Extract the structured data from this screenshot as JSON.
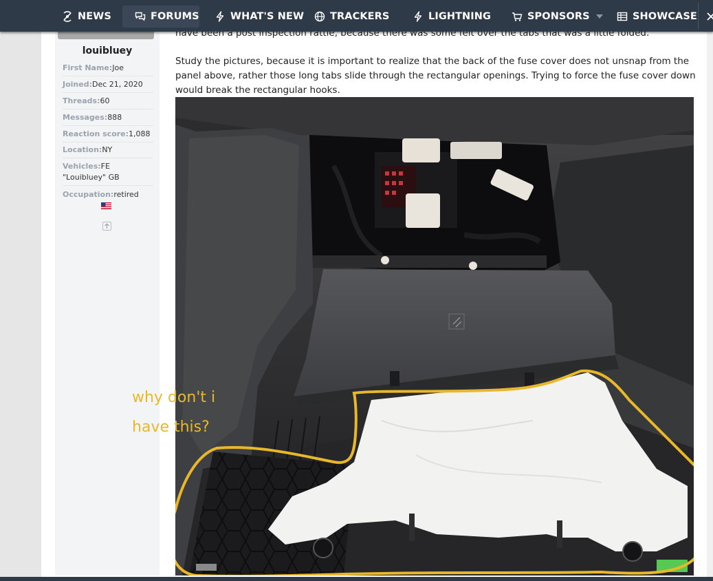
{
  "nav": {
    "items": [
      {
        "label": "NEWS",
        "icon": "satellite-icon"
      },
      {
        "label": "FORUMS",
        "icon": "chat-bubbles-icon"
      },
      {
        "label": "WHAT'S NEW",
        "icon": "lightning-bolt-icon"
      },
      {
        "label": "TRACKERS",
        "icon": "globe-icon"
      },
      {
        "label": "LIGHTNING",
        "icon": "lightning-bolt-icon"
      },
      {
        "label": "SPONSORS",
        "icon": "shopping-cart-icon"
      },
      {
        "label": "SHOWCASE",
        "icon": "grid-table-icon"
      }
    ],
    "active": "FORUMS"
  },
  "user": {
    "username": "louibluey",
    "fields": [
      {
        "key": "First Name:",
        "value": "Joe"
      },
      {
        "key": "Joined:",
        "value": "Dec 21, 2020"
      },
      {
        "key": "Threads:",
        "value": "60"
      },
      {
        "key": "Messages:",
        "value": "888"
      },
      {
        "key": "Reaction score:",
        "value": "1,088"
      },
      {
        "key": "Location:",
        "value": "NY"
      },
      {
        "key": "Vehicles:",
        "value": "FE \"Louibluey\" GB"
      },
      {
        "key": "Occupation:",
        "value": "retired"
      }
    ]
  },
  "post": {
    "top_line": "have been a post inspection rattle, because there was some felt over the tabs that was a little folded.",
    "paragraph": "Study the pictures, because it is important to realize that the back of the fuse cover does not unsnap from the panel above, rather those long tabs slide through the rectangular openings. Trying to force the fuse cover down would break the rectangular hooks.",
    "annotation_line1": "why don't i",
    "annotation_line2": "have this?"
  },
  "colors": {
    "navbar": "#2e3a48",
    "annotation": "#e8b82a"
  }
}
